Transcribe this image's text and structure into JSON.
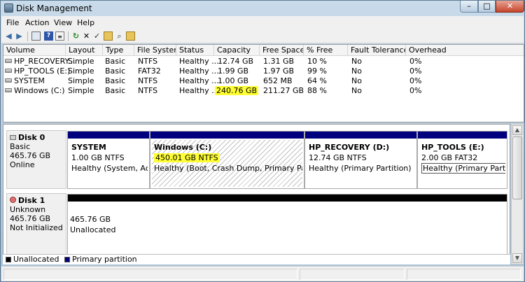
{
  "window": {
    "title": "Disk Management",
    "controls": {
      "minimize": "–",
      "maximize": "□",
      "close": "✕"
    }
  },
  "menu": [
    "File",
    "Action",
    "View",
    "Help"
  ],
  "toolbar_icons": [
    "back-arrow-icon",
    "forward-arrow-icon",
    "console-tree-icon",
    "help-icon",
    "properties-icon",
    "refresh-icon",
    "delete-icon",
    "check-icon",
    "open-icon",
    "search-icon",
    "explore-icon"
  ],
  "volumes": {
    "columns": [
      "Volume",
      "Layout",
      "Type",
      "File System",
      "Status",
      "Capacity",
      "Free Space",
      "% Free",
      "Fault Tolerance",
      "Overhead"
    ],
    "rows": [
      [
        "HP_RECOVERY...",
        "Simple",
        "Basic",
        "NTFS",
        "Healthy ...",
        "12.74 GB",
        "1.31 GB",
        "10 %",
        "No",
        "0%"
      ],
      [
        "HP_TOOLS (E:)",
        "Simple",
        "Basic",
        "FAT32",
        "Healthy ...",
        "1.99 GB",
        "1.97 GB",
        "99 %",
        "No",
        "0%"
      ],
      [
        "SYSTEM",
        "Simple",
        "Basic",
        "NTFS",
        "Healthy ...",
        "1.00 GB",
        "652 MB",
        "64 %",
        "No",
        "0%"
      ],
      [
        "Windows (C:)",
        "Simple",
        "Basic",
        "NTFS",
        "Healthy ...",
        "240.76 GB",
        "211.27 GB",
        "88 %",
        "No",
        "0%"
      ]
    ]
  },
  "disks": [
    {
      "name": "Disk 0",
      "type": "Basic",
      "size": "465.76 GB",
      "state": "Online",
      "partitions": [
        {
          "name": "SYSTEM",
          "detail": "1.00 GB NTFS",
          "status": "Healthy (System, Active"
        },
        {
          "name": "Windows  (C:)",
          "detail": "450.01 GB NTFS",
          "status": "Healthy (Boot, Crash Dump, Primary Partition)"
        },
        {
          "name": "HP_RECOVERY  (D:)",
          "detail": "12.74 GB NTFS",
          "status": "Healthy (Primary Partition)"
        },
        {
          "name": "HP_TOOLS  (E:)",
          "detail": "2.00 GB FAT32",
          "status": "Healthy (Primary Partition)"
        }
      ]
    },
    {
      "name": "Disk 1",
      "type": "Unknown",
      "size": "465.76 GB",
      "state": "Not Initialized",
      "unallocated": {
        "size": "465.76 GB",
        "label": "Unallocated"
      }
    }
  ],
  "legend": [
    {
      "label": "Unallocated",
      "color": "#000000"
    },
    {
      "label": "Primary partition",
      "color": "#00007f"
    }
  ],
  "highlight_color": "#ffff33"
}
